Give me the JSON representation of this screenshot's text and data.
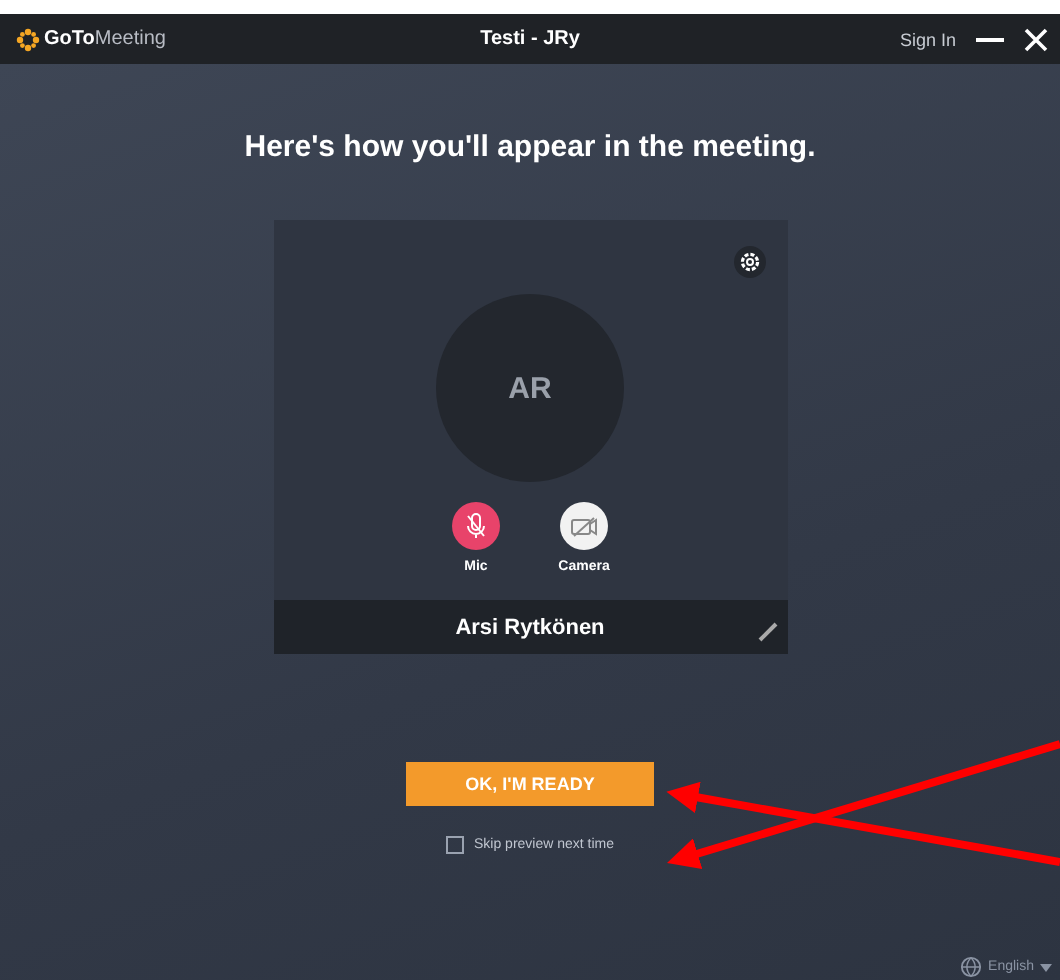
{
  "window": {
    "brand_bold": "GoTo",
    "brand_light": "Meeting",
    "title": "Testi - JRy",
    "sign_in": "Sign In"
  },
  "heading": "Here's how you'll appear in the meeting.",
  "preview": {
    "initials": "AR",
    "name": "Arsi Rytkönen",
    "controls": [
      {
        "kind": "mic",
        "label": "Mic",
        "on": false
      },
      {
        "kind": "camera",
        "label": "Camera",
        "on": false
      }
    ]
  },
  "ready_button": "OK, I'M READY",
  "skip_preview": {
    "label": "Skip preview next time",
    "checked": false
  },
  "language": "English"
}
